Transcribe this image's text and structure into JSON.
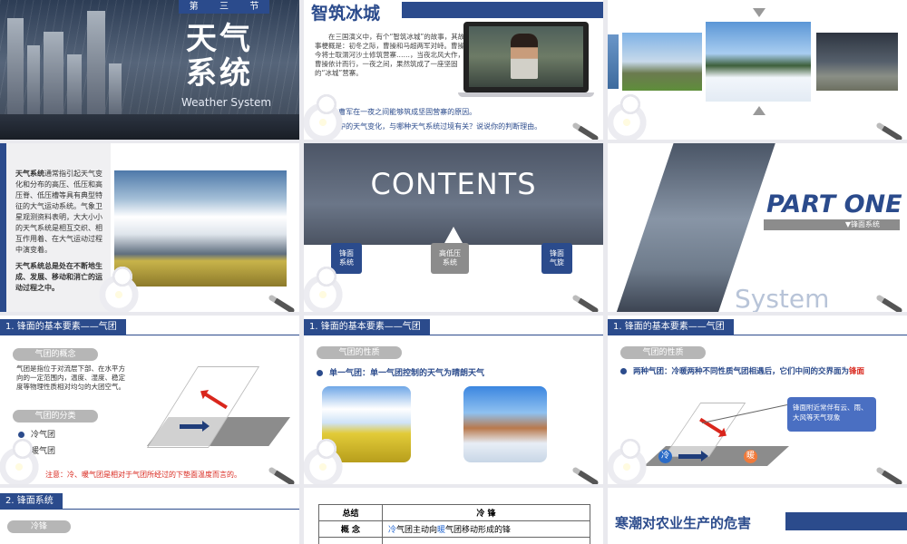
{
  "s1": {
    "badge": [
      "第",
      "三",
      "节"
    ],
    "title_line1": "天气",
    "title_line2": "系统",
    "subtitle": "Weather System"
  },
  "s2": {
    "title": "智筑冰城",
    "body": "在三国演义中，有个“智筑冰城”的故事，其故事梗概是：初冬之际，曹操和马超两军对峙。曹操今将士取渭河沙土修筑营寨……，当夜北风大作，曹操依计而行，一夜之间，果然筑成了一座坚固的“冰城”营寨。",
    "q1": "1. 讨论曹军在一夜之间能够筑成坚固营寨的原因。",
    "q2": "2. 故事中的天气变化，与哪种天气系统过境有关？说说你的判断理由。"
  },
  "s4": {
    "p1_bold": "天气系统",
    "p1": "通常指引起天气变化和分布的高压、低压和高压脊、低压槽等具有典型特征的大气运动系统。气象卫星观测资料表明，大大小小的天气系统是相互交织、相互作用着、在大气运动过程中演变着。",
    "p2": "天气系统总是处在不断地生成、发展、移动和消亡的运动过程之中。"
  },
  "s5": {
    "title": "CONTENTS",
    "items": [
      "锋面\n系统",
      "高低压\n系统",
      "锋面\n气旋"
    ]
  },
  "s6": {
    "part": "PART ONE",
    "sub": "▼锋面系统",
    "bg_word": "System"
  },
  "s7": {
    "header": "1. 锋面的基本要素——气团",
    "pill1": "气团的概念",
    "concept": "气团是指位于对流层下部、在水平方向的一定范围内，温度、湿度、稳定度等物理性质相对均匀的大团空气。",
    "pill2": "气团的分类",
    "cls1": "冷气团",
    "cls2": "暖气团",
    "note": "注意：冷、暖气团是相对于气团所经过的下垫面温度而言的。"
  },
  "s8": {
    "header": "1. 锋面的基本要素——气团",
    "pill": "气团的性质",
    "point": "单一气团：单一气团控制的天气为晴朗天气"
  },
  "s9": {
    "header": "1. 锋面的基本要素——气团",
    "pill": "气团的性质",
    "point": "两种气团：冷暖两种不同性质气团相遇后，它们中间的交界面为",
    "point_red": "锋面",
    "callout": "锋面附近常伴有云、雨、大风等天气现象",
    "cold": "冷",
    "warm": "暖"
  },
  "s10": {
    "header": "2. 锋面系统",
    "pill": "冷锋"
  },
  "s11": {
    "r1": [
      "总结",
      "冷  锋"
    ],
    "r2_label": "概  念",
    "r2_a": "冷",
    "r2_b": "气团主动向",
    "r2_c": "暖",
    "r2_d": "气团移动形成的锋"
  },
  "s12": {
    "title": "寒潮对农业生产的危害"
  },
  "colors": {
    "brand": "#2b4b8c",
    "accent_red": "#d9261c",
    "warm": "#f07a3a",
    "cold": "#2a6bc7"
  }
}
